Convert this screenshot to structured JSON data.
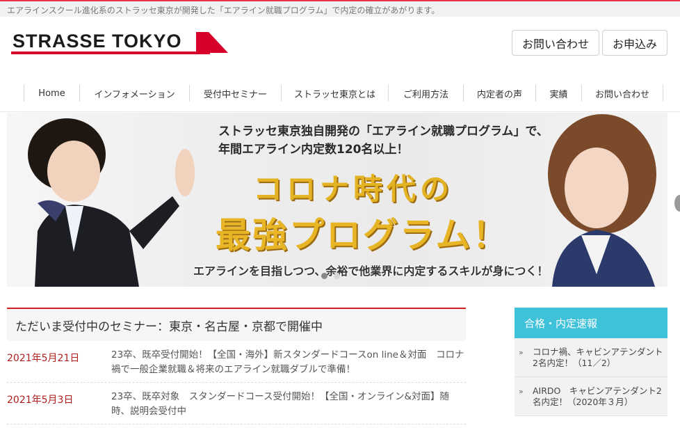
{
  "topbar": {
    "text": "エアラインスクール進化系のストラッセ東京が開発した「エアライン就職プログラム」で内定の確立があがります。"
  },
  "logo": {
    "text": "STRASSE TOKYO",
    "accent_color": "#d6002a"
  },
  "header_buttons": {
    "contact": "お問い合わせ",
    "apply": "お申込み"
  },
  "nav": {
    "items": [
      {
        "label": "Home"
      },
      {
        "label": "インフォメーション"
      },
      {
        "label": "受付中セミナー"
      },
      {
        "label": "ストラッセ東京とは"
      },
      {
        "label": "ご利用方法"
      },
      {
        "label": "内定者の声"
      },
      {
        "label": "実績"
      },
      {
        "label": "お問い合わせ"
      }
    ]
  },
  "hero": {
    "line1": "ストラッセ東京独自開発の「エアライン就職プログラム」で、",
    "line2": "年間エアライン内定数120名以上！",
    "big1": "コロナ時代の",
    "big2": "最強プログラム！",
    "bottom": "エアラインを目指しつつ、余裕で他業界に内定するスキルが身につく！",
    "gold_color": "#e3b323"
  },
  "seminar": {
    "title": "ただいま受付中のセミナー：東京・名古屋・京都で開催中",
    "rows": [
      {
        "date": "2021年5月21日",
        "text": "23卒、既卒受付開始！【全国・海外】新スタンダードコースon line＆対面　コロナ禍で一般企業就職＆将来のエアライン就職ダブルで準備！"
      },
      {
        "date": "2021年5月3日",
        "text": "23卒、既卒対象　スタンダードコース受付開始！【全国・オンライン&対面】随時、説明会受付中"
      }
    ]
  },
  "sidebar": {
    "title": "合格・内定速報",
    "head_color": "#3fc2d9",
    "items": [
      {
        "mark": "»",
        "text": "コロナ禍、キャビンアテンダント2名内定！（11／2）"
      },
      {
        "mark": "»",
        "text": "AIRDO　キャビンアテンダント2名内定！（2020年３月）"
      }
    ]
  }
}
